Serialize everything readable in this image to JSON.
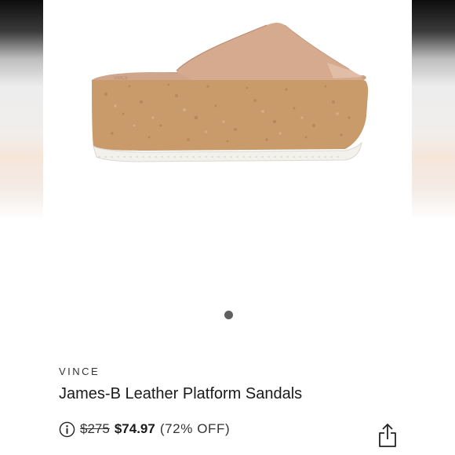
{
  "product": {
    "brand": "VINCE",
    "title": "James-B Leather Platform Sandals",
    "original_price": "$275",
    "sale_price": "$74.97",
    "discount": "(72% OFF)"
  },
  "carousel": {
    "dot_count": 1,
    "active_index": 0
  },
  "icons": {
    "info": "info-circle-icon",
    "share": "share-icon"
  },
  "colors": {
    "text": "#1a1a1a",
    "dot_active": "#5f5f5f",
    "background": "#ffffff"
  }
}
